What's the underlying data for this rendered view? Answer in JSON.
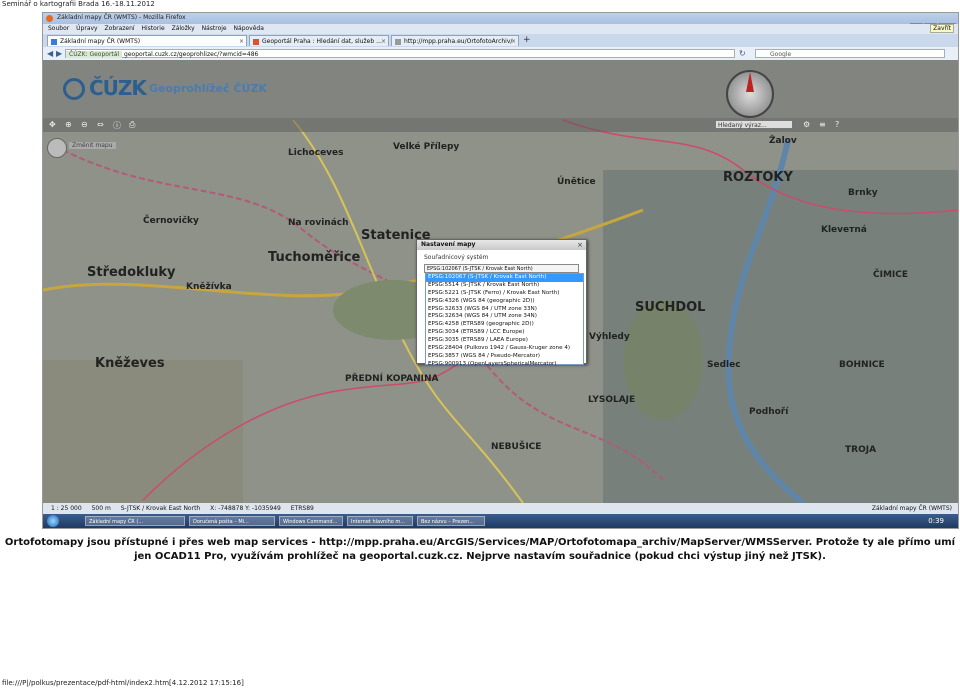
{
  "print_header": "Seminář o kartografii Brada 16.-18.11.2012",
  "browser": {
    "window_title": "Základní mapy ČR (WMTS) - Mozilla Firefox",
    "menu": [
      "Soubor",
      "Úpravy",
      "Zobrazení",
      "Historie",
      "Záložky",
      "Nástroje",
      "Nápověda"
    ],
    "close_tooltip": "Zavřít",
    "tabs": [
      {
        "label": "Základní mapy ČR (WMTS)",
        "active": true
      },
      {
        "label": "Geoportál Praha : Hledání dat, služeb ...",
        "active": false
      },
      {
        "label": "http://mpp.praha.eu/OrtofotoArchiv/",
        "active": false
      }
    ],
    "new_tab": "+",
    "url_site": "ČÚZK: Geoportál",
    "url": "geoportal.cuzk.cz/geoprohlizec/?wmcid=486",
    "search_engine": "Google"
  },
  "app": {
    "logo": "ČÚZK",
    "title": "Geoprohlížeč ČÚZK",
    "search_placeholder": "Hledaný výraz...",
    "zoom_label": "Změnit mapu"
  },
  "map_labels": [
    {
      "text": "ROZTOKY",
      "big": true
    },
    {
      "text": "Statenice",
      "big": true
    },
    {
      "text": "Tuchoměřice",
      "big": true
    },
    {
      "text": "Středokluky",
      "big": true
    },
    {
      "text": "Kněževes",
      "big": true
    },
    {
      "text": "PŘEDNÍ KOPANINA",
      "big": false
    },
    {
      "text": "SUCHDOL",
      "big": true
    },
    {
      "text": "BOHNICE",
      "big": false
    },
    {
      "text": "ČIMICE",
      "big": false
    },
    {
      "text": "Lichoceves",
      "big": false
    },
    {
      "text": "Velké Přílepy",
      "big": false
    },
    {
      "text": "Únětice",
      "big": false
    },
    {
      "text": "Černovičky",
      "big": false
    },
    {
      "text": "Na rovinách",
      "big": false
    },
    {
      "text": "Kněžívka",
      "big": false
    },
    {
      "text": "Výhledy",
      "big": false
    },
    {
      "text": "LYSOLAJE",
      "big": false
    },
    {
      "text": "NEBUŠICE",
      "big": false
    },
    {
      "text": "TROJA",
      "big": false
    },
    {
      "text": "Kleveтná",
      "big": false
    },
    {
      "text": "Brnky",
      "big": false
    },
    {
      "text": "Sedlec",
      "big": false
    },
    {
      "text": "Podhoří",
      "big": false
    },
    {
      "text": "Žalov",
      "big": false
    }
  ],
  "dialog": {
    "title": "Nastavení mapy",
    "close": "×",
    "label": "Souřadnicový systém",
    "selected": "EPSG:102067 (S-JTSK / Krovak East North)",
    "options": [
      "EPSG:102067 (S-JTSK / Krovak East North)",
      "EPSG:5514 (S-JTSK / Krovak East North)",
      "EPSG:5221 (S-JTSK (Ferro) / Krovak East North)",
      "EPSG:4326 (WGS 84 (geographic 2D))",
      "EPSG:32633 (WGS 84 / UTM zone 33N)",
      "EPSG:32634 (WGS 84 / UTM zone 34N)",
      "EPSG:4258 (ETRS89 (geographic 2D))",
      "EPSG:3034 (ETRS89 / LCC Europe)",
      "EPSG:3035 (ETRS89 / LAEA Europe)",
      "EPSG:28404 (Pulkovo 1942 / Gauss-Kruger zone 4)",
      "EPSG:3857 (WGS 84 / Pseudo-Mercator)",
      "EPSG:900913 (OpenLayersSphericalMercator)"
    ]
  },
  "status": {
    "scale": "1 : 25 000",
    "scalebar": "500 m",
    "crs": "S-JTSK / Krovak East North",
    "coords": "X: -748878 Y: -1035949",
    "etrs": "ETRS89",
    "right": "Základní mapy ČR (WMTS)"
  },
  "taskbar": {
    "items": [
      "Základní mapy ČR (...",
      "Doručená pošta – Mi...",
      "Windows Command...",
      "Internet hlavního m...",
      "Bez názvu – Prezen..."
    ],
    "clock": "0:39"
  },
  "caption": "Ortofotomapy jsou přístupné i přes web map services - http://mpp.praha.eu/ArcGIS/Services/MAP/Ortofotomapa_archiv/MapServer/WMSServer. Protože ty ale přímo umí jen OCAD11 Pro, využívám prohlížeč na geoportal.cuzk.cz. Nejprve nastavím souřadnice (pokud chci výstup jiný než JTSK).",
  "footer": "file:///P|/polkus/prezentace/pdf-html/index2.htm[4.12.2012 17:15:16]"
}
